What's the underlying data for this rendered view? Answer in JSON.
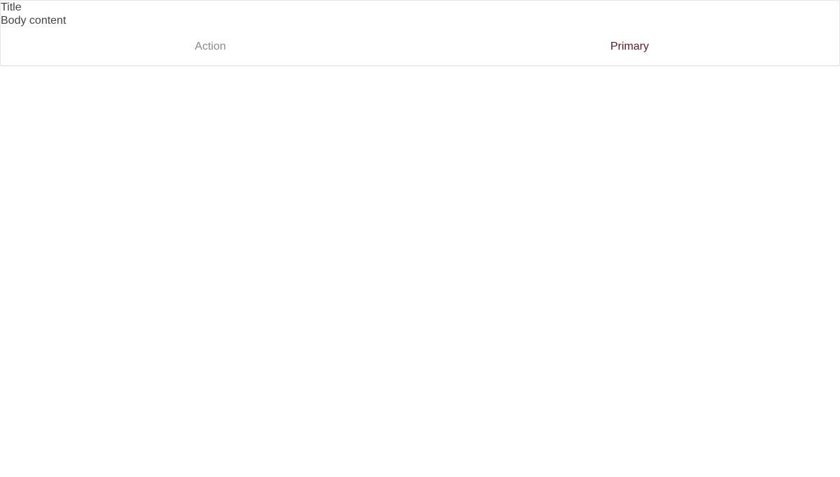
{
  "card": {
    "title": "Title",
    "body": "Body content",
    "actions": {
      "secondary_label": "Action",
      "primary_label": "Primary"
    }
  },
  "colors": {
    "text": "#444444",
    "secondary_action": "#8a8a8a",
    "primary_action": "#5a1a28",
    "border": "#e6e6e6"
  }
}
